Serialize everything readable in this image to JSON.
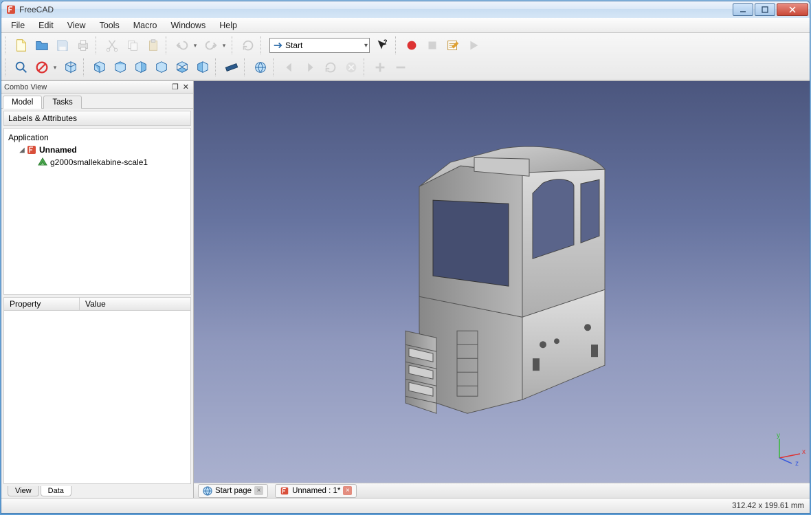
{
  "window_title": "FreeCAD",
  "menu": {
    "file": "File",
    "edit": "Edit",
    "view": "View",
    "tools": "Tools",
    "macro": "Macro",
    "windows": "Windows",
    "help": "Help"
  },
  "toolbar": {
    "start": "Start"
  },
  "combo_view": {
    "title": "Combo View",
    "tabs": {
      "model": "Model",
      "tasks": "Tasks"
    },
    "labels_header": "Labels & Attributes",
    "tree": {
      "root": "Application",
      "doc": "Unnamed",
      "obj": "g2000smallekabine-scale1"
    },
    "property": {
      "col1": "Property",
      "col2": "Value"
    },
    "bottom_tabs": {
      "view": "View",
      "data": "Data"
    }
  },
  "viewer_tabs": {
    "start_page": "Start page",
    "doc_tab": "Unnamed : 1*"
  },
  "status": {
    "dimensions": "312.42 x 199.61  mm"
  },
  "axes": {
    "x": "x",
    "y": "y",
    "z": "z"
  }
}
